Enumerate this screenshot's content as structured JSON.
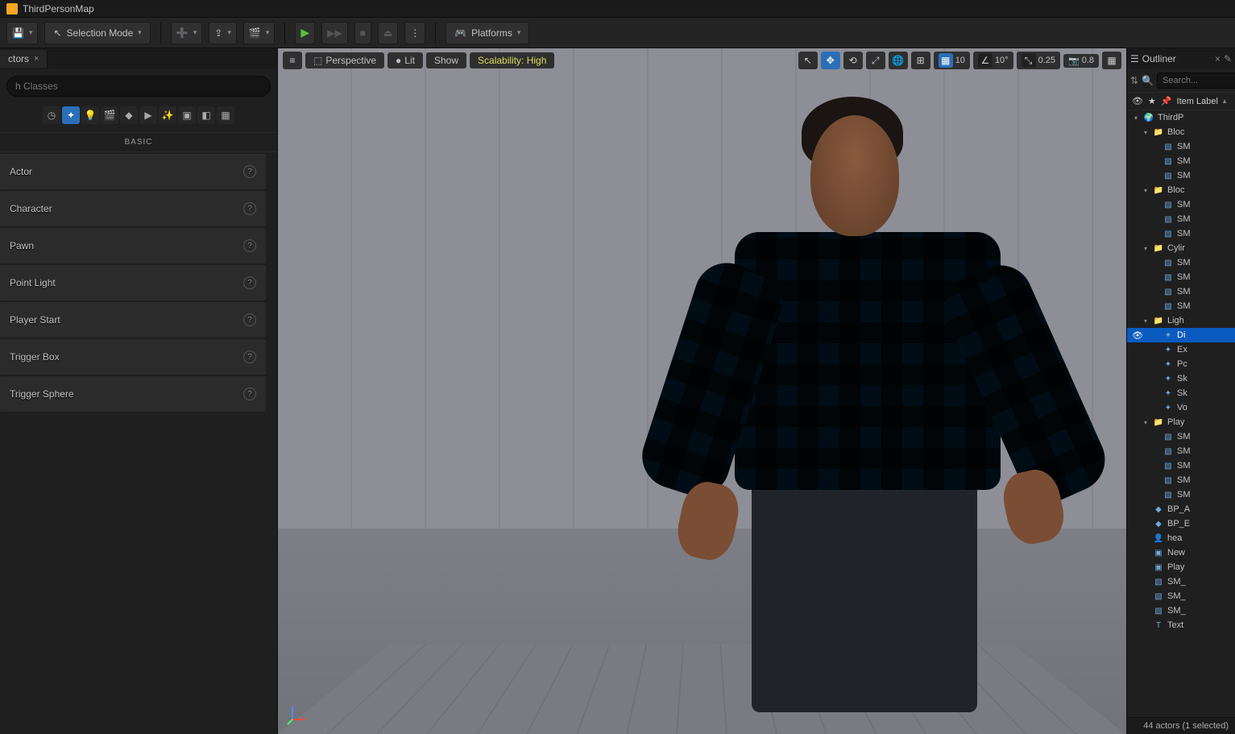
{
  "title": "ThirdPersonMap",
  "toolbar": {
    "mode_label": "Selection Mode",
    "platforms_label": "Platforms"
  },
  "place_actors": {
    "tab_label": "ctors",
    "search_placeholder": "h Classes",
    "section_header": "BASIC",
    "items": [
      {
        "label": "Actor"
      },
      {
        "label": "Character"
      },
      {
        "label": "Pawn"
      },
      {
        "label": "Point Light"
      },
      {
        "label": "Player Start"
      },
      {
        "label": "Trigger Box"
      },
      {
        "label": "Trigger Sphere"
      }
    ]
  },
  "viewport": {
    "perspective_label": "Perspective",
    "lit_label": "Lit",
    "show_label": "Show",
    "scalability_label": "Scalability: High",
    "snap_grid": "10",
    "snap_angle": "10°",
    "snap_scale": "0.25",
    "cam_speed": "0.8"
  },
  "outliner": {
    "tab_label": "Outliner",
    "search_placeholder": "Search...",
    "col_label": "Item Label",
    "root": "ThirdP",
    "footer": "44 actors (1 selected)",
    "rows": [
      {
        "ind": 1,
        "type": "folder",
        "label": "Bloc",
        "tw": "▾"
      },
      {
        "ind": 2,
        "type": "mesh",
        "label": "SM"
      },
      {
        "ind": 2,
        "type": "mesh",
        "label": "SM"
      },
      {
        "ind": 2,
        "type": "mesh",
        "label": "SM"
      },
      {
        "ind": 1,
        "type": "folder",
        "label": "Bloc",
        "tw": "▾"
      },
      {
        "ind": 2,
        "type": "mesh",
        "label": "SM"
      },
      {
        "ind": 2,
        "type": "mesh",
        "label": "SM"
      },
      {
        "ind": 2,
        "type": "mesh",
        "label": "SM"
      },
      {
        "ind": 1,
        "type": "folder",
        "label": "Cylir",
        "tw": "▾"
      },
      {
        "ind": 2,
        "type": "mesh",
        "label": "SM"
      },
      {
        "ind": 2,
        "type": "mesh",
        "label": "SM"
      },
      {
        "ind": 2,
        "type": "mesh",
        "label": "SM"
      },
      {
        "ind": 2,
        "type": "mesh",
        "label": "SM"
      },
      {
        "ind": 1,
        "type": "folder",
        "label": "Ligh",
        "tw": "▾"
      },
      {
        "ind": 2,
        "type": "light",
        "label": "Di",
        "sel": true
      },
      {
        "ind": 2,
        "type": "light",
        "label": "Ex"
      },
      {
        "ind": 2,
        "type": "light",
        "label": "Pc"
      },
      {
        "ind": 2,
        "type": "light",
        "label": "Sk"
      },
      {
        "ind": 2,
        "type": "light",
        "label": "Sk"
      },
      {
        "ind": 2,
        "type": "light",
        "label": "Vo"
      },
      {
        "ind": 1,
        "type": "folder",
        "label": "Play",
        "tw": "▾"
      },
      {
        "ind": 2,
        "type": "mesh",
        "label": "SM"
      },
      {
        "ind": 2,
        "type": "mesh",
        "label": "SM"
      },
      {
        "ind": 2,
        "type": "mesh",
        "label": "SM"
      },
      {
        "ind": 2,
        "type": "mesh",
        "label": "SM"
      },
      {
        "ind": 2,
        "type": "mesh",
        "label": "SM"
      },
      {
        "ind": 1,
        "type": "bp",
        "label": "BP_A"
      },
      {
        "ind": 1,
        "type": "bp",
        "label": "BP_E"
      },
      {
        "ind": 1,
        "type": "char",
        "label": "hea"
      },
      {
        "ind": 1,
        "type": "actor",
        "label": "New"
      },
      {
        "ind": 1,
        "type": "actor",
        "label": "Play"
      },
      {
        "ind": 1,
        "type": "mesh",
        "label": "SM_"
      },
      {
        "ind": 1,
        "type": "mesh",
        "label": "SM_"
      },
      {
        "ind": 1,
        "type": "mesh",
        "label": "SM_"
      },
      {
        "ind": 1,
        "type": "text",
        "label": "Text"
      }
    ]
  }
}
